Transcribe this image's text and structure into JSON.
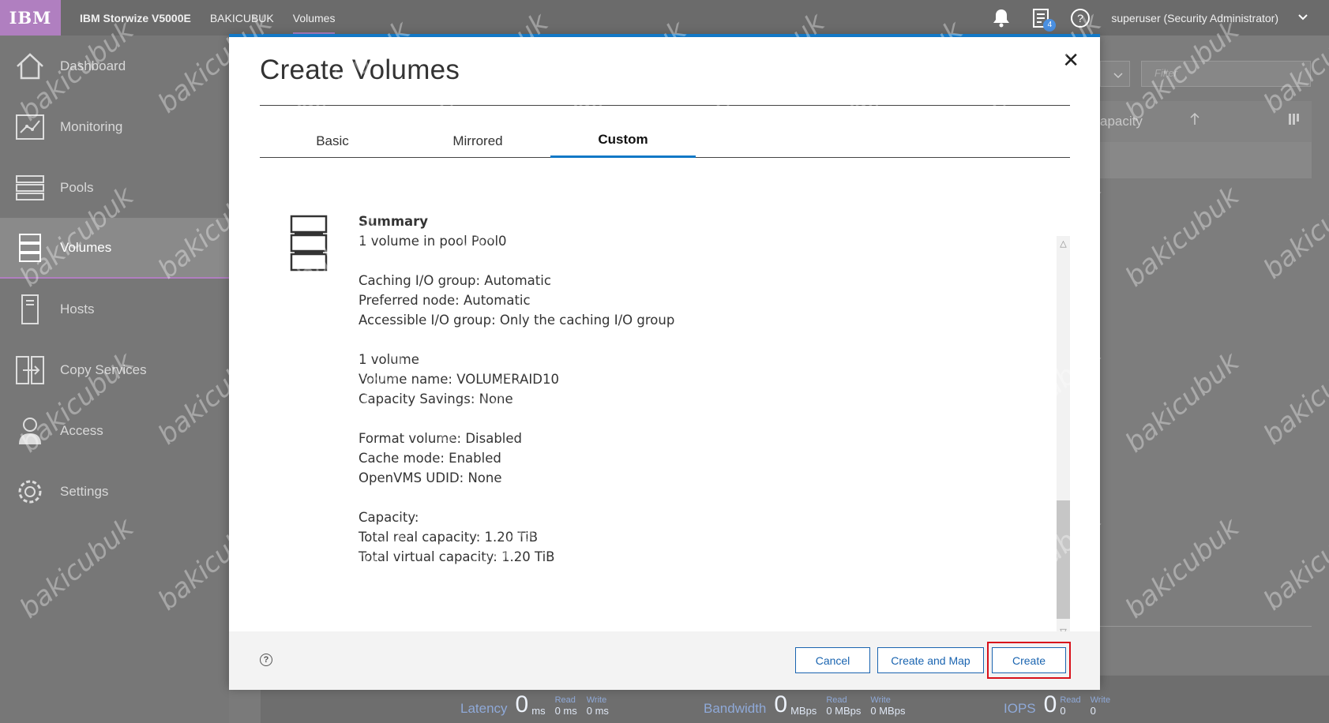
{
  "topbar": {
    "logo": "IBM",
    "product": "IBM Storwize V5000E",
    "system": "BAKICUBUK",
    "section": "Volumes",
    "tasks_badge": "4",
    "user": "superuser (Security Administrator)"
  },
  "sidebar": {
    "items": [
      {
        "label": "Dashboard",
        "icon": "home-icon"
      },
      {
        "label": "Monitoring",
        "icon": "monitoring-icon"
      },
      {
        "label": "Pools",
        "icon": "pools-icon"
      },
      {
        "label": "Volumes",
        "icon": "volumes-icon",
        "active": true
      },
      {
        "label": "Hosts",
        "icon": "hosts-icon"
      },
      {
        "label": "Copy Services",
        "icon": "copy-services-icon"
      },
      {
        "label": "Access",
        "icon": "access-icon"
      },
      {
        "label": "Settings",
        "icon": "settings-icon"
      }
    ]
  },
  "background": {
    "filter_placeholder": "Filter",
    "column_header": "apacity"
  },
  "modal": {
    "title": "Create Volumes",
    "tabs": [
      "Basic",
      "Mirrored",
      "Custom"
    ],
    "active_tab": "Custom",
    "summary": {
      "heading": "Summary",
      "line1": "1 volume in pool Pool0",
      "caching": "Caching I/O group: Automatic",
      "preferred": "Preferred node: Automatic",
      "accessible": "Accessible I/O group: Only the caching I/O group",
      "count": "1 volume",
      "name": "Volume name: VOLUMERAID10",
      "savings": "Capacity Savings: None",
      "format": "Format volume: Disabled",
      "cache": "Cache mode: Enabled",
      "openvms": "OpenVMS UDID: None",
      "capacity": "Capacity:",
      "real": "Total real capacity: 1.20 TiB",
      "virtual": "Total virtual capacity: 1.20 TiB"
    },
    "buttons": {
      "cancel": "Cancel",
      "create_and_map": "Create and Map",
      "create": "Create"
    }
  },
  "statusbar": {
    "latency": {
      "label": "Latency",
      "value": "0",
      "unit": "ms",
      "read": "0 ms",
      "write": "0 ms"
    },
    "bandwidth": {
      "label": "Bandwidth",
      "value": "0",
      "unit": "MBps",
      "read": "0 MBps",
      "write": "0 MBps"
    },
    "iops": {
      "label": "IOPS",
      "value": "0",
      "read": "0",
      "write": "0"
    },
    "read_label": "Read",
    "write_label": "Write"
  },
  "watermark": "bakicubuk",
  "colors": {
    "accent": "#1278c6",
    "brand": "#b07fc0",
    "highlight": "#d8111b"
  }
}
